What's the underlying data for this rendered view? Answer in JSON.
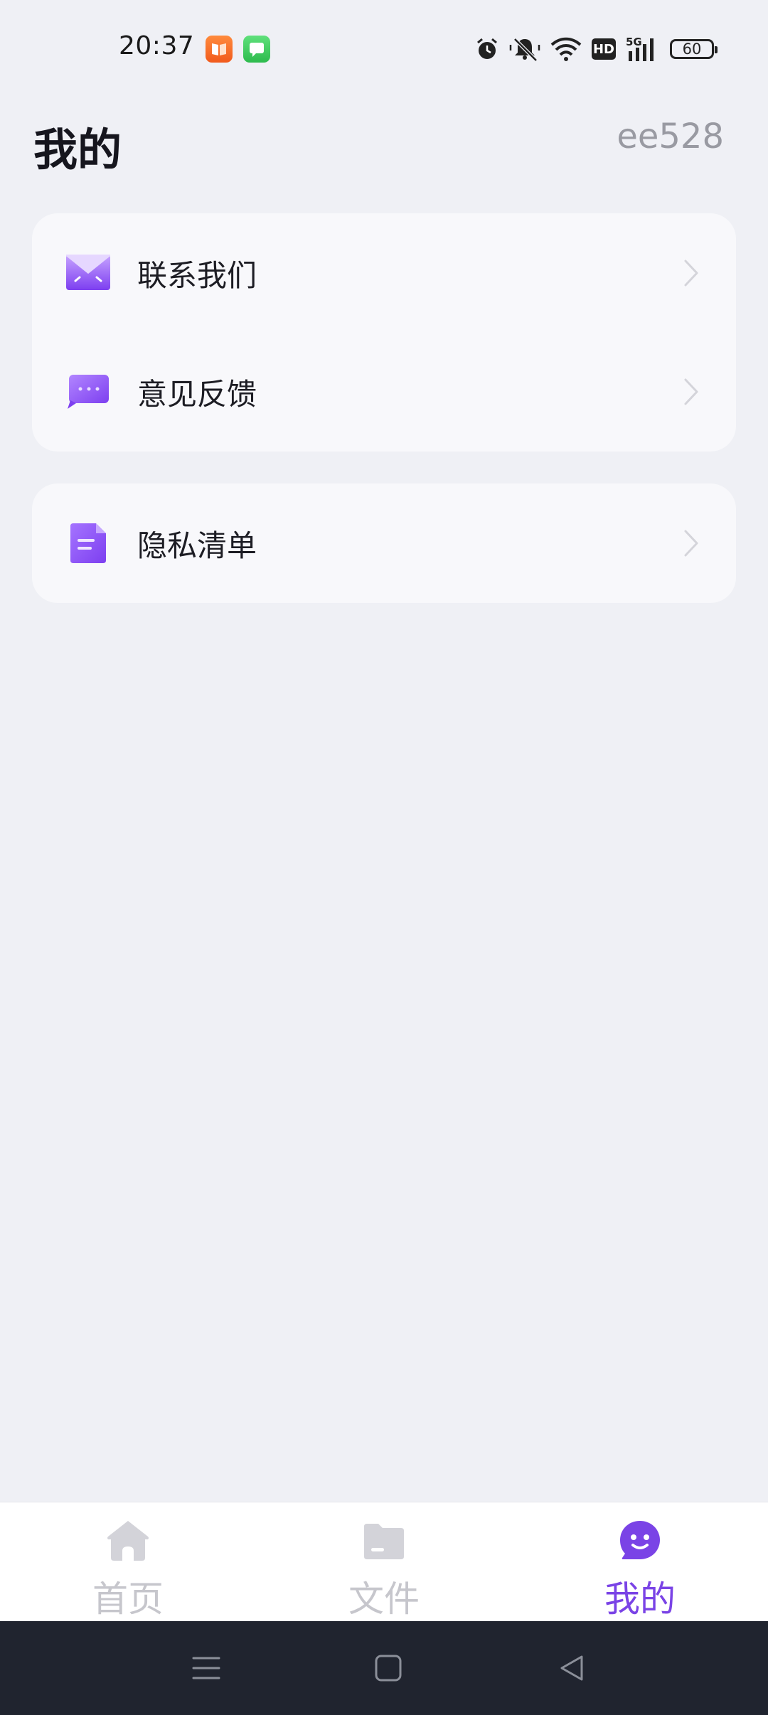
{
  "status_bar": {
    "time": "20:37",
    "notification_icons": [
      "book-app-icon",
      "messages-app-icon"
    ],
    "system_icons": [
      "alarm-icon",
      "silent-icon",
      "wifi-icon",
      "hd-icon",
      "5g-signal-icon",
      "battery-icon"
    ],
    "hd_label": "HD",
    "network_label": "5G",
    "battery_level": "60"
  },
  "header": {
    "title": "我的",
    "user_id": "ee528"
  },
  "menu": {
    "group1": [
      {
        "label": "联系我们",
        "icon": "mail-icon"
      },
      {
        "label": "意见反馈",
        "icon": "chat-bubble-icon"
      }
    ],
    "group2": [
      {
        "label": "隐私清单",
        "icon": "document-icon"
      }
    ]
  },
  "tab_bar": {
    "tabs": [
      {
        "label": "首页",
        "icon": "home-icon",
        "active": false
      },
      {
        "label": "文件",
        "icon": "folder-icon",
        "active": false
      },
      {
        "label": "我的",
        "icon": "smile-icon",
        "active": true
      }
    ]
  },
  "colors": {
    "accent": "#7a43e6",
    "background": "#eff0f5",
    "card": "#f8f8fb",
    "inactive_tab": "#c6c6cc",
    "nav_bar": "#20242f"
  }
}
